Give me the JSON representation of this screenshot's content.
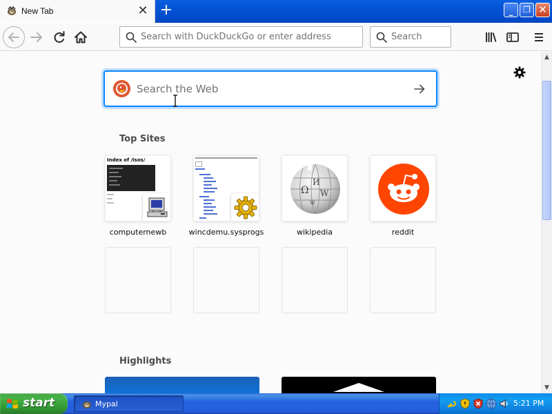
{
  "window": {
    "tab_title": "New Tab",
    "tab_close_glyph": "✕",
    "new_tab_glyph": "+",
    "min_glyph": "_",
    "max_glyph": "❐",
    "close_glyph": "✕"
  },
  "toolbar": {
    "url_placeholder": "Search with DuckDuckGo or enter address",
    "search_placeholder": "Search"
  },
  "newtab": {
    "search_placeholder": "Search the Web",
    "top_sites_title": "Top Sites",
    "highlights_title": "Highlights",
    "top_sites": [
      {
        "label": "computernewb"
      },
      {
        "label": "wincdemu.sysprogs"
      },
      {
        "label": "wikipedia"
      },
      {
        "label": "reddit"
      }
    ],
    "thumb_computernewb_title": "Index of /isos/"
  },
  "taskbar": {
    "start_label": "start",
    "task_label": "Mypal",
    "clock": "5:21 PM"
  },
  "colors": {
    "accent": "#0a84ff",
    "duckduckgo": "#de5833",
    "reddit": "#ff4500",
    "xp_blue": "#0454d4",
    "xp_green": "#339933"
  },
  "icons": [
    "mypal-icon",
    "close-icon",
    "plus-icon",
    "back-arrow-icon",
    "forward-arrow-icon",
    "reload-icon",
    "home-icon",
    "search-icon",
    "library-icon",
    "sidebar-icon",
    "hamburger-menu-icon",
    "gear-icon",
    "duckduckgo-icon",
    "arrow-right-icon",
    "windows-logo-icon"
  ]
}
